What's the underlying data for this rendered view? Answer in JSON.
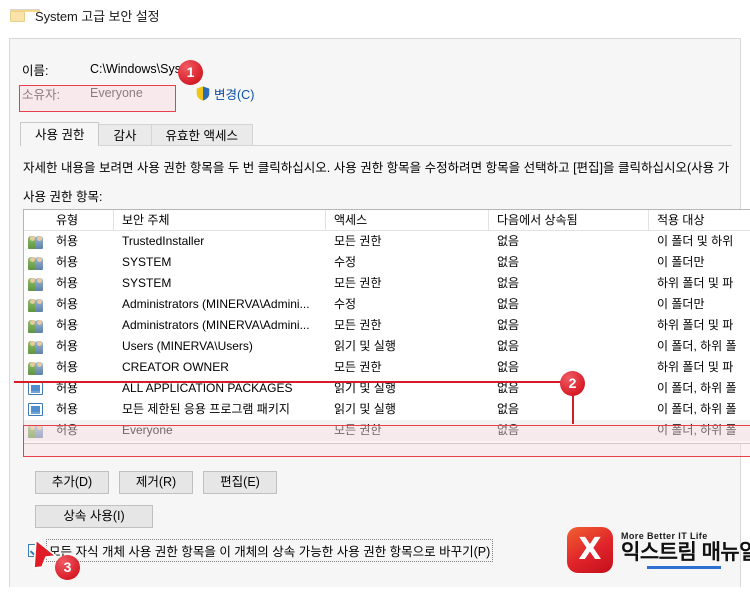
{
  "titlebar": {
    "icon": "folder-icon",
    "title": "System 고급 보안 설정"
  },
  "info": {
    "name_label": "이름:",
    "name_value": "C:\\Windows\\System",
    "owner_label": "소유자:",
    "owner_value": "Everyone",
    "change_link": "변경(C)",
    "shield_icon": "shield-icon"
  },
  "tabs": [
    {
      "label": "사용 권한",
      "active": true
    },
    {
      "label": "감사",
      "active": false
    },
    {
      "label": "유효한 액세스",
      "active": false
    }
  ],
  "description": "자세한 내용을 보려면 사용 권한 항목을 두 번 클릭하십시오. 사용 권한 항목을 수정하려면 항목을 선택하고 [편집]을 클릭하십시오(사용 가",
  "section_label": "사용 권한 항목:",
  "table": {
    "columns": [
      "",
      "유형",
      "보안 주체",
      "액세스",
      "다음에서 상속됨",
      "적용 대상"
    ],
    "rows": [
      {
        "icon": "users-icon",
        "type": "허용",
        "principal": "TrustedInstaller",
        "access": "모든 권한",
        "inherited": "없음",
        "applies": "이 폴더 및 하위",
        "selected": false
      },
      {
        "icon": "users-icon",
        "type": "허용",
        "principal": "SYSTEM",
        "access": "수정",
        "inherited": "없음",
        "applies": "이 폴더만",
        "selected": false
      },
      {
        "icon": "users-icon",
        "type": "허용",
        "principal": "SYSTEM",
        "access": "모든 권한",
        "inherited": "없음",
        "applies": "하위 폴더 및 파",
        "selected": false
      },
      {
        "icon": "users-icon",
        "type": "허용",
        "principal": "Administrators (MINERVA\\Admini...",
        "access": "수정",
        "inherited": "없음",
        "applies": "이 폴더만",
        "selected": false
      },
      {
        "icon": "users-icon",
        "type": "허용",
        "principal": "Administrators (MINERVA\\Admini...",
        "access": "모든 권한",
        "inherited": "없음",
        "applies": "하위 폴더 및 파",
        "selected": false
      },
      {
        "icon": "users-icon",
        "type": "허용",
        "principal": "Users (MINERVA\\Users)",
        "access": "읽기 및 실행",
        "inherited": "없음",
        "applies": "이 폴더, 하위 폴",
        "selected": false
      },
      {
        "icon": "users-icon",
        "type": "허용",
        "principal": "CREATOR OWNER",
        "access": "모든 권한",
        "inherited": "없음",
        "applies": "하위 폴더 및 파",
        "selected": false
      },
      {
        "icon": "package-icon",
        "type": "허용",
        "principal": "ALL APPLICATION PACKAGES",
        "access": "읽기 및 실행",
        "inherited": "없음",
        "applies": "이 폴더, 하위 폴",
        "selected": false
      },
      {
        "icon": "package-icon",
        "type": "허용",
        "principal": "모든 제한된 응용 프로그램 패키지",
        "access": "읽기 및 실행",
        "inherited": "없음",
        "applies": "이 폴더, 하위 폴",
        "selected": false
      },
      {
        "icon": "users-icon",
        "type": "허용",
        "principal": "Everyone",
        "access": "모든 권한",
        "inherited": "없음",
        "applies": "이 폴더, 하위 폴",
        "selected": true
      }
    ]
  },
  "buttons": {
    "add": "추가(D)",
    "remove": "제거(R)",
    "edit": "편집(E)",
    "enable_inheritance": "상속 사용(I)"
  },
  "checkbox": {
    "label": "모든 자식 개체 사용 권한 항목을 이 개체의 상속 가능한 사용 권한 항목으로 바꾸기(P)",
    "checked": true
  },
  "annotations": [
    {
      "number": "1"
    },
    {
      "number": "2"
    },
    {
      "number": "3"
    }
  ],
  "watermark": {
    "tagline": "More Better IT Life",
    "brand": "익스트림 매뉴얼",
    "logo_glyph": "X"
  },
  "colors": {
    "accent_red": "#d61c27",
    "link_blue": "#0b4fa8",
    "highlight_pink": "#fae0e4",
    "selected_row": "#f2f2f2"
  }
}
